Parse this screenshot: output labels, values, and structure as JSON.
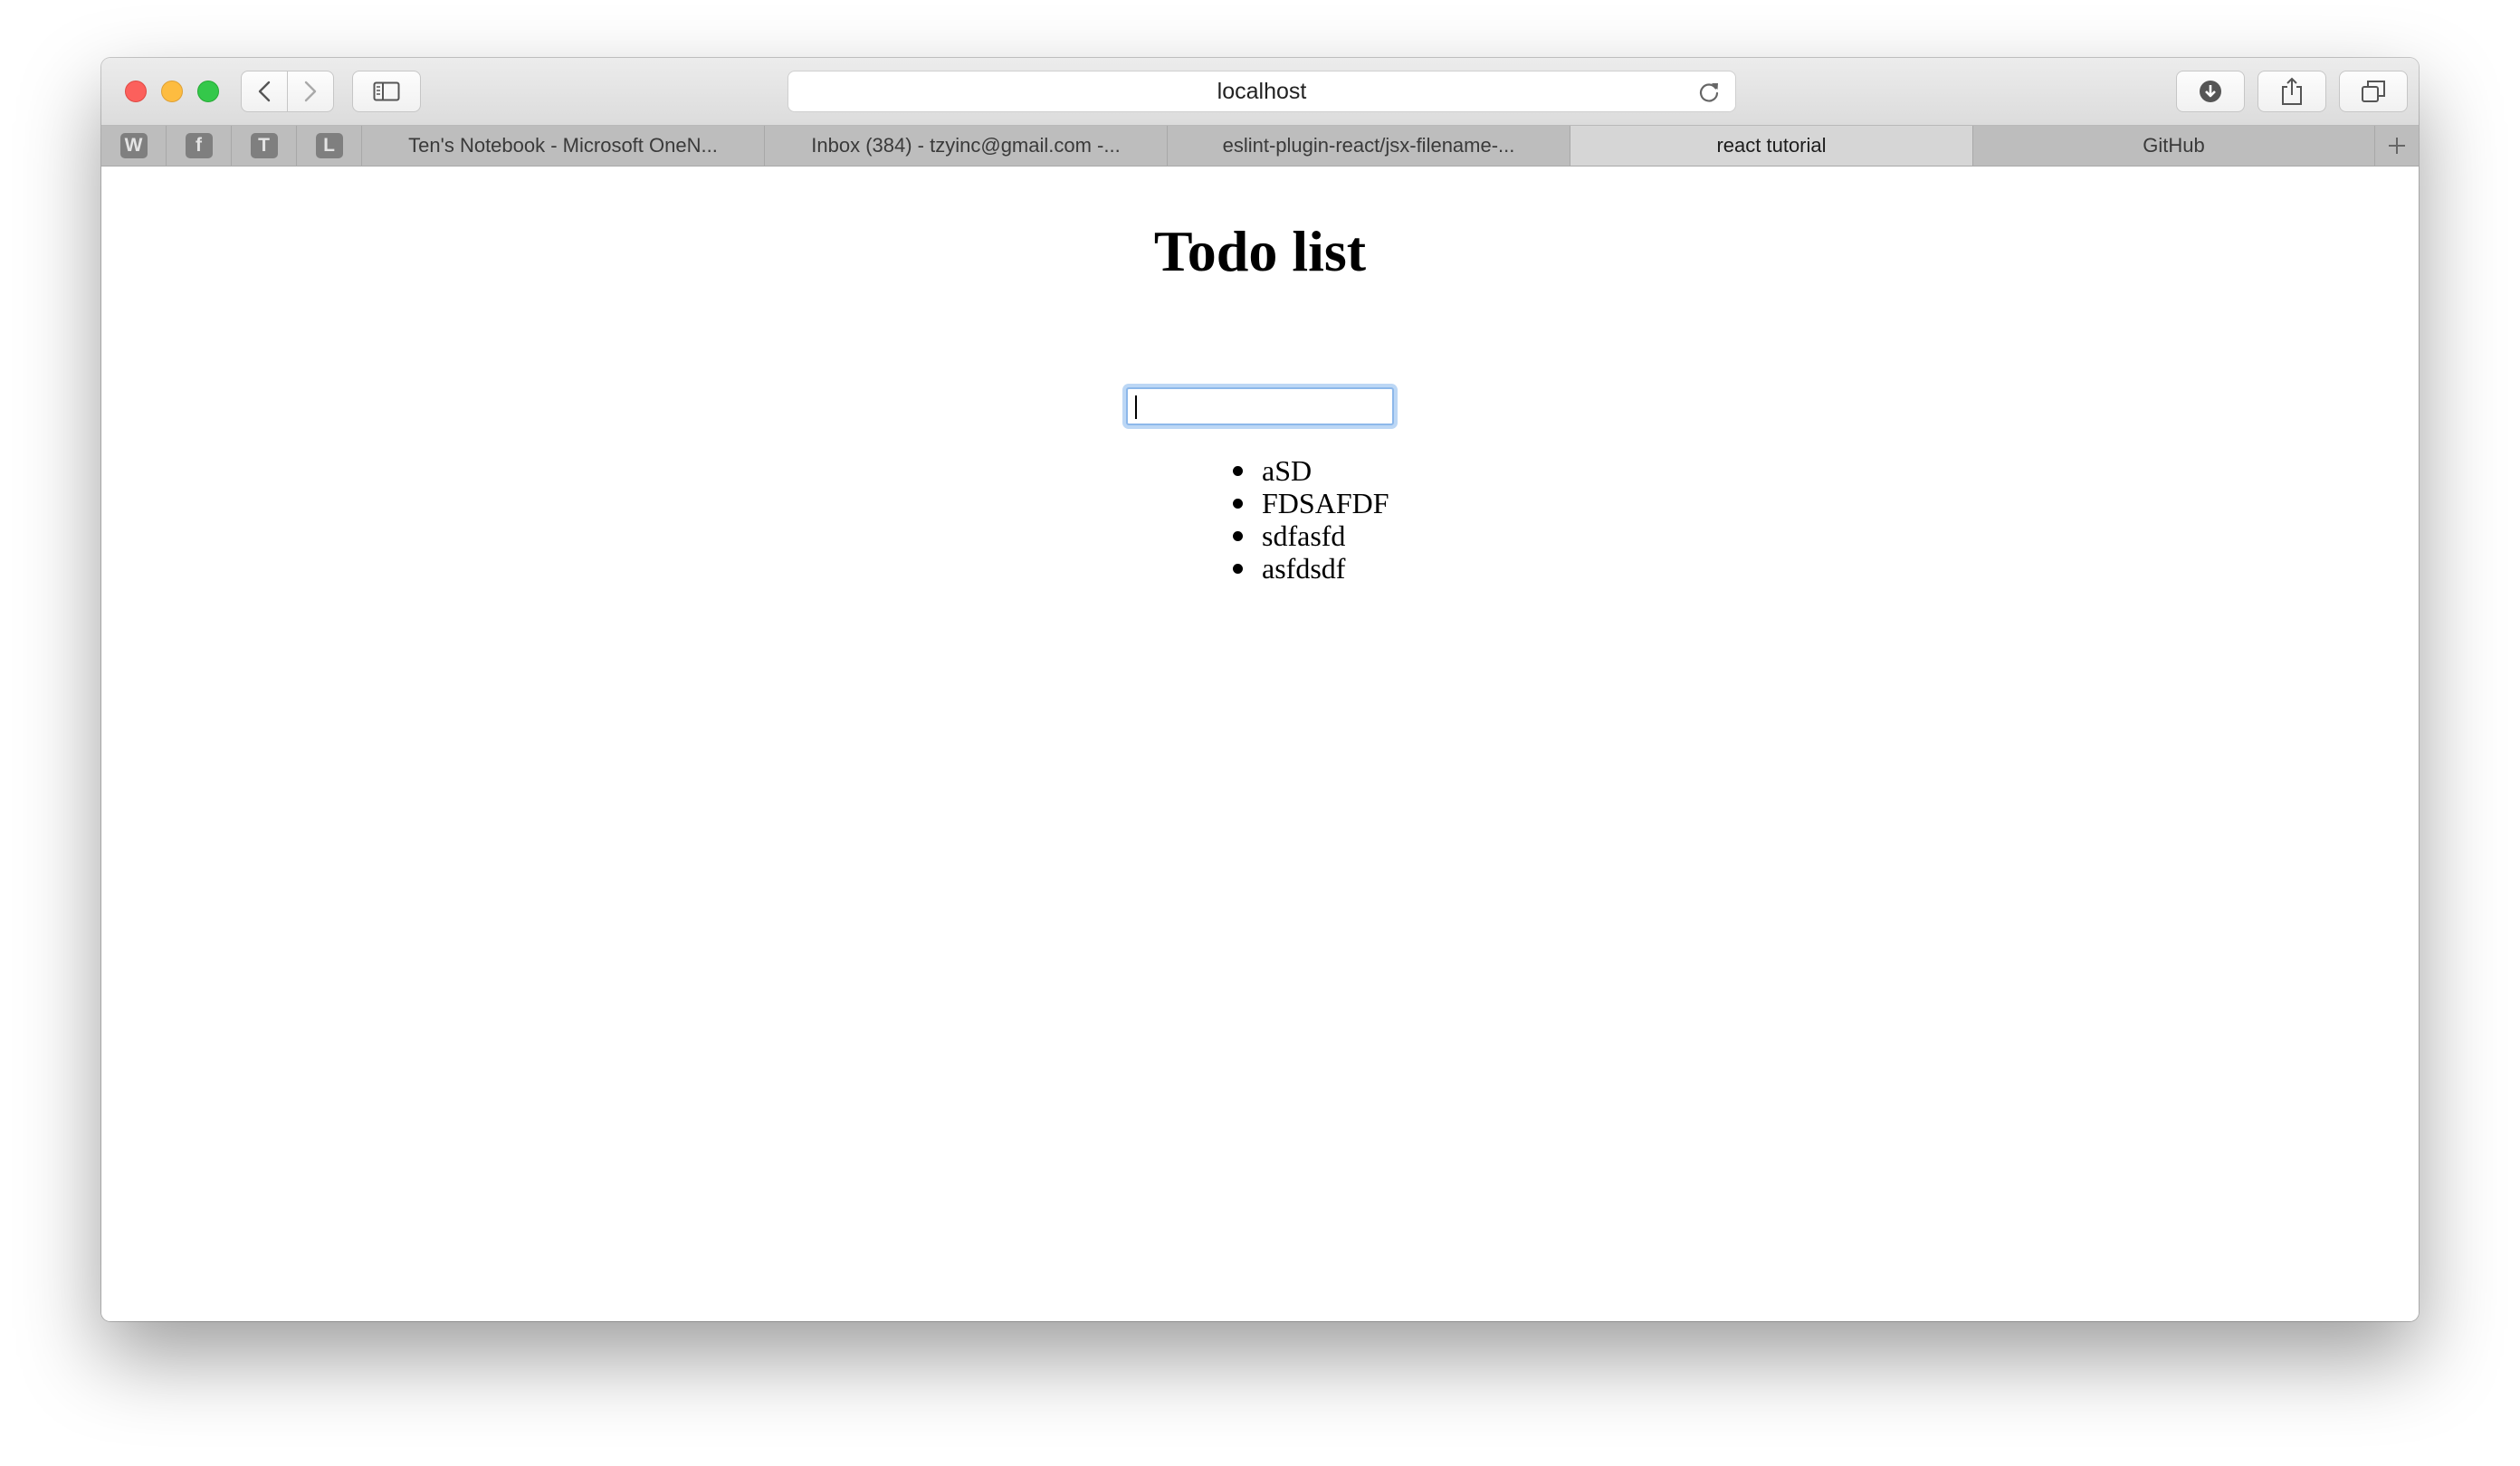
{
  "browser": {
    "address": "localhost",
    "pinned_tabs": [
      {
        "icon": "wikipedia-icon",
        "glyph": "W"
      },
      {
        "icon": "facebook-icon",
        "glyph": "f"
      },
      {
        "icon": "t-site-icon",
        "glyph": "T"
      },
      {
        "icon": "l-site-icon",
        "glyph": "L"
      }
    ],
    "tabs": [
      {
        "label": "Ten's Notebook - Microsoft OneN..."
      },
      {
        "label": "Inbox (384) - tzyinc@gmail.com -..."
      },
      {
        "label": "eslint-plugin-react/jsx-filename-..."
      },
      {
        "label": "react tutorial",
        "active": true
      },
      {
        "label": "GitHub"
      }
    ],
    "colors": {
      "close": "#fc605c",
      "minimize": "#fdbc40",
      "maximize": "#34c84a",
      "focus_ring": "#8db8ea"
    }
  },
  "page": {
    "title": "Todo list",
    "input_value": "",
    "items": [
      "aSD",
      "FDSAFDF",
      "sdfasfd",
      "asfdsdf"
    ]
  }
}
